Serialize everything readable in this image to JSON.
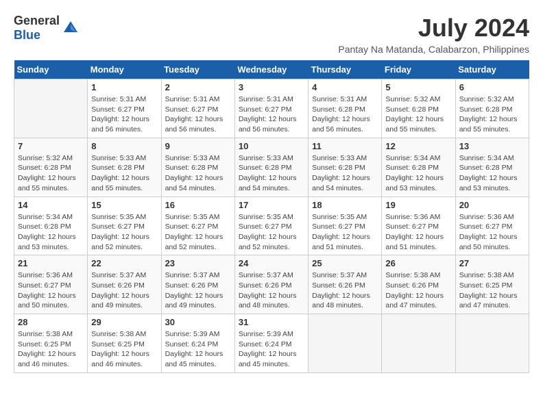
{
  "header": {
    "logo_general": "General",
    "logo_blue": "Blue",
    "month_year": "July 2024",
    "location": "Pantay Na Matanda, Calabarzon, Philippines"
  },
  "calendar": {
    "days_of_week": [
      "Sunday",
      "Monday",
      "Tuesday",
      "Wednesday",
      "Thursday",
      "Friday",
      "Saturday"
    ],
    "weeks": [
      [
        {
          "day": "",
          "sunrise": "",
          "sunset": "",
          "daylight": ""
        },
        {
          "day": "1",
          "sunrise": "Sunrise: 5:31 AM",
          "sunset": "Sunset: 6:27 PM",
          "daylight": "Daylight: 12 hours and 56 minutes."
        },
        {
          "day": "2",
          "sunrise": "Sunrise: 5:31 AM",
          "sunset": "Sunset: 6:27 PM",
          "daylight": "Daylight: 12 hours and 56 minutes."
        },
        {
          "day": "3",
          "sunrise": "Sunrise: 5:31 AM",
          "sunset": "Sunset: 6:27 PM",
          "daylight": "Daylight: 12 hours and 56 minutes."
        },
        {
          "day": "4",
          "sunrise": "Sunrise: 5:31 AM",
          "sunset": "Sunset: 6:28 PM",
          "daylight": "Daylight: 12 hours and 56 minutes."
        },
        {
          "day": "5",
          "sunrise": "Sunrise: 5:32 AM",
          "sunset": "Sunset: 6:28 PM",
          "daylight": "Daylight: 12 hours and 55 minutes."
        },
        {
          "day": "6",
          "sunrise": "Sunrise: 5:32 AM",
          "sunset": "Sunset: 6:28 PM",
          "daylight": "Daylight: 12 hours and 55 minutes."
        }
      ],
      [
        {
          "day": "7",
          "sunrise": "Sunrise: 5:32 AM",
          "sunset": "Sunset: 6:28 PM",
          "daylight": "Daylight: 12 hours and 55 minutes."
        },
        {
          "day": "8",
          "sunrise": "Sunrise: 5:33 AM",
          "sunset": "Sunset: 6:28 PM",
          "daylight": "Daylight: 12 hours and 55 minutes."
        },
        {
          "day": "9",
          "sunrise": "Sunrise: 5:33 AM",
          "sunset": "Sunset: 6:28 PM",
          "daylight": "Daylight: 12 hours and 54 minutes."
        },
        {
          "day": "10",
          "sunrise": "Sunrise: 5:33 AM",
          "sunset": "Sunset: 6:28 PM",
          "daylight": "Daylight: 12 hours and 54 minutes."
        },
        {
          "day": "11",
          "sunrise": "Sunrise: 5:33 AM",
          "sunset": "Sunset: 6:28 PM",
          "daylight": "Daylight: 12 hours and 54 minutes."
        },
        {
          "day": "12",
          "sunrise": "Sunrise: 5:34 AM",
          "sunset": "Sunset: 6:28 PM",
          "daylight": "Daylight: 12 hours and 53 minutes."
        },
        {
          "day": "13",
          "sunrise": "Sunrise: 5:34 AM",
          "sunset": "Sunset: 6:28 PM",
          "daylight": "Daylight: 12 hours and 53 minutes."
        }
      ],
      [
        {
          "day": "14",
          "sunrise": "Sunrise: 5:34 AM",
          "sunset": "Sunset: 6:28 PM",
          "daylight": "Daylight: 12 hours and 53 minutes."
        },
        {
          "day": "15",
          "sunrise": "Sunrise: 5:35 AM",
          "sunset": "Sunset: 6:27 PM",
          "daylight": "Daylight: 12 hours and 52 minutes."
        },
        {
          "day": "16",
          "sunrise": "Sunrise: 5:35 AM",
          "sunset": "Sunset: 6:27 PM",
          "daylight": "Daylight: 12 hours and 52 minutes."
        },
        {
          "day": "17",
          "sunrise": "Sunrise: 5:35 AM",
          "sunset": "Sunset: 6:27 PM",
          "daylight": "Daylight: 12 hours and 52 minutes."
        },
        {
          "day": "18",
          "sunrise": "Sunrise: 5:35 AM",
          "sunset": "Sunset: 6:27 PM",
          "daylight": "Daylight: 12 hours and 51 minutes."
        },
        {
          "day": "19",
          "sunrise": "Sunrise: 5:36 AM",
          "sunset": "Sunset: 6:27 PM",
          "daylight": "Daylight: 12 hours and 51 minutes."
        },
        {
          "day": "20",
          "sunrise": "Sunrise: 5:36 AM",
          "sunset": "Sunset: 6:27 PM",
          "daylight": "Daylight: 12 hours and 50 minutes."
        }
      ],
      [
        {
          "day": "21",
          "sunrise": "Sunrise: 5:36 AM",
          "sunset": "Sunset: 6:27 PM",
          "daylight": "Daylight: 12 hours and 50 minutes."
        },
        {
          "day": "22",
          "sunrise": "Sunrise: 5:37 AM",
          "sunset": "Sunset: 6:26 PM",
          "daylight": "Daylight: 12 hours and 49 minutes."
        },
        {
          "day": "23",
          "sunrise": "Sunrise: 5:37 AM",
          "sunset": "Sunset: 6:26 PM",
          "daylight": "Daylight: 12 hours and 49 minutes."
        },
        {
          "day": "24",
          "sunrise": "Sunrise: 5:37 AM",
          "sunset": "Sunset: 6:26 PM",
          "daylight": "Daylight: 12 hours and 48 minutes."
        },
        {
          "day": "25",
          "sunrise": "Sunrise: 5:37 AM",
          "sunset": "Sunset: 6:26 PM",
          "daylight": "Daylight: 12 hours and 48 minutes."
        },
        {
          "day": "26",
          "sunrise": "Sunrise: 5:38 AM",
          "sunset": "Sunset: 6:26 PM",
          "daylight": "Daylight: 12 hours and 47 minutes."
        },
        {
          "day": "27",
          "sunrise": "Sunrise: 5:38 AM",
          "sunset": "Sunset: 6:25 PM",
          "daylight": "Daylight: 12 hours and 47 minutes."
        }
      ],
      [
        {
          "day": "28",
          "sunrise": "Sunrise: 5:38 AM",
          "sunset": "Sunset: 6:25 PM",
          "daylight": "Daylight: 12 hours and 46 minutes."
        },
        {
          "day": "29",
          "sunrise": "Sunrise: 5:38 AM",
          "sunset": "Sunset: 6:25 PM",
          "daylight": "Daylight: 12 hours and 46 minutes."
        },
        {
          "day": "30",
          "sunrise": "Sunrise: 5:39 AM",
          "sunset": "Sunset: 6:24 PM",
          "daylight": "Daylight: 12 hours and 45 minutes."
        },
        {
          "day": "31",
          "sunrise": "Sunrise: 5:39 AM",
          "sunset": "Sunset: 6:24 PM",
          "daylight": "Daylight: 12 hours and 45 minutes."
        },
        {
          "day": "",
          "sunrise": "",
          "sunset": "",
          "daylight": ""
        },
        {
          "day": "",
          "sunrise": "",
          "sunset": "",
          "daylight": ""
        },
        {
          "day": "",
          "sunrise": "",
          "sunset": "",
          "daylight": ""
        }
      ]
    ]
  }
}
